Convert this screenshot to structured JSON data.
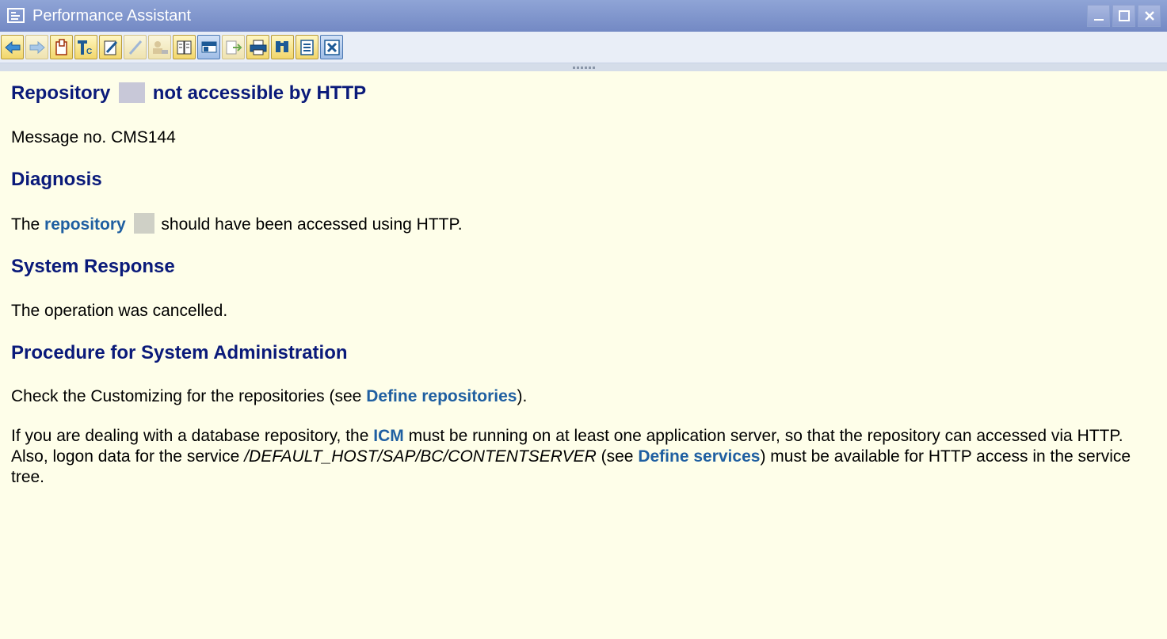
{
  "window": {
    "title": "Performance Assistant",
    "controls": [
      "minimize",
      "maximize",
      "close"
    ]
  },
  "toolbar": {
    "buttons": [
      {
        "name": "back",
        "icon": "arrow-left-icon"
      },
      {
        "name": "forward",
        "icon": "arrow-right-icon"
      },
      {
        "name": "document",
        "icon": "document-icon"
      },
      {
        "name": "technical-info",
        "icon": "technical-info-icon"
      },
      {
        "name": "edit",
        "icon": "edit-pencil-icon"
      },
      {
        "name": "edit-disabled",
        "icon": "pencil-icon"
      },
      {
        "name": "person",
        "icon": "person-icon"
      },
      {
        "name": "book",
        "icon": "book-icon"
      },
      {
        "name": "navigate",
        "icon": "navigation-icon"
      },
      {
        "name": "export",
        "icon": "export-icon"
      },
      {
        "name": "print",
        "icon": "printer-icon"
      },
      {
        "name": "find",
        "icon": "binoculars-icon"
      },
      {
        "name": "settings",
        "icon": "list-icon"
      },
      {
        "name": "close",
        "icon": "close-icon"
      }
    ]
  },
  "message": {
    "title_before": "Repository",
    "title_after": "not accessible by HTTP",
    "number": "Message no. CMS144"
  },
  "sections": {
    "diagnosis": {
      "heading": "Diagnosis",
      "text_before": "The",
      "link": "repository",
      "text_after": "should have been accessed using HTTP."
    },
    "system_response": {
      "heading": "System Response",
      "text": "The operation was cancelled."
    },
    "procedure": {
      "heading": "Procedure for System Administration",
      "p1_before": "Check the Customizing for the repositories (see",
      "p1_link": "Define repositories",
      "p1_after": ").",
      "p2_before": "If you are dealing with a database repository, the",
      "p2_link1": "ICM",
      "p2_mid1": "must be running on at least one application server, so that the repository can accessed via HTTP. Also, logon data for the service",
      "p2_path": "/DEFAULT_HOST/SAP/BC/CONTENTSERVER",
      "p2_mid2": "(see",
      "p2_link2": "Define services",
      "p2_after": ") must be available for HTTP access in the service tree."
    }
  },
  "colors": {
    "heading": "#0a1a7a",
    "link": "#1f5fa1",
    "background": "#fefee9",
    "titlebar": "#8fa4d6"
  }
}
